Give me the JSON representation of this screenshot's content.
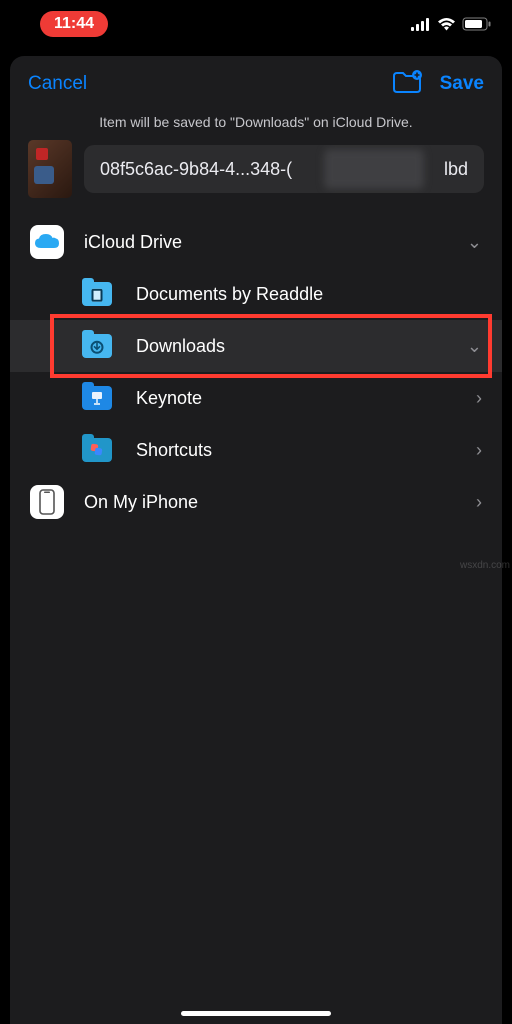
{
  "status": {
    "time": "11:44"
  },
  "nav": {
    "cancel": "Cancel",
    "save": "Save"
  },
  "info": "Item will be saved to \"Downloads\" on iCloud Drive.",
  "file": {
    "name_visible": "08f5c6ac-9b84-4...348-(",
    "name_tail": "lbd"
  },
  "locations": {
    "icloud": {
      "label": "iCloud Drive",
      "children": [
        {
          "id": "documents-readdle",
          "label": "Documents by Readdle",
          "icon": "folder-doc",
          "disclosure": ""
        },
        {
          "id": "downloads",
          "label": "Downloads",
          "icon": "folder-download",
          "disclosure": "chevron-down",
          "selected": true
        },
        {
          "id": "keynote",
          "label": "Keynote",
          "icon": "folder-keynote",
          "disclosure": "chevron-right"
        },
        {
          "id": "shortcuts",
          "label": "Shortcuts",
          "icon": "folder-shortcuts",
          "disclosure": "chevron-right"
        }
      ]
    },
    "oniphone": {
      "label": "On My iPhone",
      "disclosure": "chevron-right"
    }
  },
  "watermark": "wsxdn.com"
}
